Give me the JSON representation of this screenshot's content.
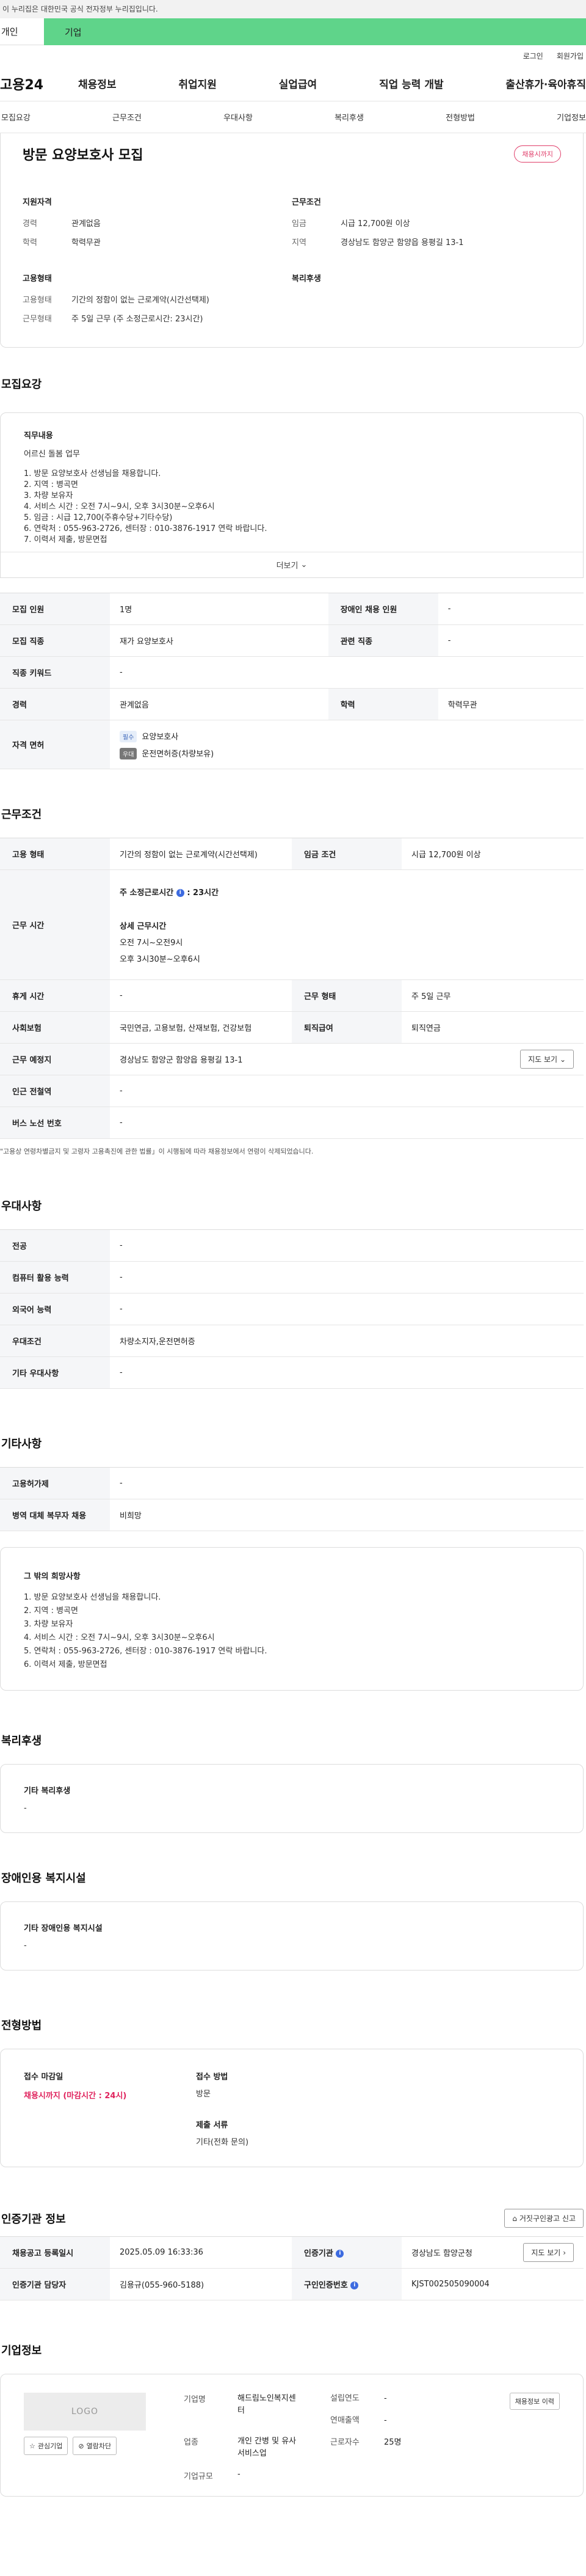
{
  "gov_banner": "이 누리집은 대한민국 공식 전자정부 누리집입니다.",
  "tabs": {
    "individual": "개인",
    "business": "기업"
  },
  "utility": {
    "login": "로그인",
    "signup": "회원가입"
  },
  "gnb": {
    "logo": "고용24",
    "items": [
      "채용정보",
      "취업지원",
      "실업급여",
      "직업 능력 개발",
      "출산휴가·육아휴직"
    ]
  },
  "subnav": [
    "모집요강",
    "근무조건",
    "우대사항",
    "복리후생",
    "전형방법",
    "기업정보"
  ],
  "summary": {
    "title": "방문 요양보호사 모집",
    "deadline_badge": "채용시까지",
    "qualification": {
      "head": "지원자격",
      "career_k": "경력",
      "career_v": "관계없음",
      "edu_k": "학력",
      "edu_v": "학력무관"
    },
    "conditions": {
      "head": "근무조건",
      "wage_k": "임금",
      "wage_v": "시급 12,700원 이상",
      "area_k": "지역",
      "area_v": "경상남도 함양군 함양읍 용평길 13-1"
    },
    "employment": {
      "head": "고용형태",
      "type_k": "고용형태",
      "type_v": "기간의 정함이 없는 근로계약(시간선택제)",
      "time_k": "근무형태",
      "time_v": "주 5일 근무 (주 소정근로시간: 23시간)"
    },
    "welfare": {
      "head": "복리후생"
    }
  },
  "requirements": {
    "section_title": "모집요강",
    "duty_label": "직무내용",
    "duty_lines": [
      "어르신 돌봄 업무",
      "",
      "1. 방문 요양보호사 선생님을 채용합니다.",
      "2. 지역 : 병곡면",
      "3. 차량 보유자",
      "4. 서비스 시간 : 오전 7시~9시, 오후 3시30분~오후6시",
      "5. 임금 : 시급 12,700(주휴수당+기타수당)",
      "6. 연락처 : 055-963-2726, 센터장 : 010-3876-1917 연락 바랍니다.",
      "7. 이력서 제출, 방문면접"
    ],
    "more": "더보기",
    "table": {
      "headcount_k": "모집 인원",
      "headcount_v": "1명",
      "disabled_k": "장애인 채용 인원",
      "disabled_v": "-",
      "job_k": "모집 직종",
      "job_v": "재가 요양보호사",
      "related_k": "관련 직종",
      "related_v": "-",
      "keyword_k": "직종 키워드",
      "keyword_v": "-",
      "career_k": "경력",
      "career_v": "관계없음",
      "edu_k": "학력",
      "edu_v": "학력무관",
      "license_k": "자격 면허",
      "license_req_chip": "필수",
      "license_req": "요양보호사",
      "license_opt_chip": "우대",
      "license_opt": "운전면허증(차량보유)"
    }
  },
  "work": {
    "section_title": "근무조건",
    "type_k": "고용 형태",
    "type_v": "기간의 정함이 없는 근로계약(시간선택제)",
    "wage_k": "임금 조건",
    "wage_v": "시급 12,700원 이상",
    "hours_k": "근무 시간",
    "hours_total": "주 소정근로시간",
    "hours_total_v": ": 23시간",
    "hours_detail_head": "상세 근무시간",
    "hours_detail_1": "오전 7시~오전9시",
    "hours_detail_2": "오후 3시30분~오후6시",
    "break_k": "휴게 시간",
    "break_v": "-",
    "shift_k": "근무 형태",
    "shift_v": "주 5일 근무",
    "insurance_k": "사회보험",
    "insurance_v": "국민연금, 고용보험, 산재보험, 건강보험",
    "severance_k": "퇴직급여",
    "severance_v": "퇴직연금",
    "location_k": "근무 예정지",
    "location_v": "경상남도 함양군 함양읍 용평길 13-1",
    "map_btn": "지도 보기",
    "subway_k": "인근 전철역",
    "subway_v": "-",
    "bus_k": "버스 노선 번호",
    "bus_v": "-",
    "note": "\"고용상 연령차별금지 및 고령자 고용촉진에 관한 법률」이 시행됨에 따라 채용정보에서 연령이 삭제되었습니다."
  },
  "preferences": {
    "section_title": "우대사항",
    "major_k": "전공",
    "major_v": "-",
    "computer_k": "컴퓨터 활용 능력",
    "computer_v": "-",
    "language_k": "외국어 능력",
    "language_v": "-",
    "pref_k": "우대조건",
    "pref_v": "차량소지자,운전면허증",
    "etc_k": "기타 우대사항",
    "etc_v": "-"
  },
  "others": {
    "section_title": "기타사항",
    "equipment_k": "고용허가제",
    "equipment_v": "-",
    "military_k": "병역 대체 복무자 채용",
    "military_v": "비희망",
    "hope_label": "그 밖의 희망사항",
    "hope_lines": [
      "1. 방문 요양보호사 선생님을 채용합니다.",
      "2. 지역 : 병곡면",
      "3. 차량 보유자",
      "4. 서비스 시간 : 오전 7시~9시, 오후 3시30분~오후6시",
      "5. 연락처 : 055-963-2726, 센터장 : 010-3876-1917 연락 바랍니다.",
      "6. 이력서 제출, 방문면접"
    ]
  },
  "welfare": {
    "section_title": "복리후생",
    "label": "기타 복리후생",
    "value": "-"
  },
  "disability": {
    "section_title": "장애인용 복지시설",
    "label": "기타 장애인용 복지시설",
    "value": "-"
  },
  "selection": {
    "section_title": "전형방법",
    "deadline_label": "접수 마감일",
    "deadline_value": "채용시까지 (마감시간 : 24시)",
    "method_label": "접수 방법",
    "method_value": "방문",
    "docs_label": "제출 서류",
    "docs_value": "기타(전화 문의)"
  },
  "certification": {
    "section_title": "인증기관 정보",
    "report_btn": "거짓구인광고 신고",
    "reg_k": "채용공고 등록일시",
    "reg_v": "2025.05.09 16:33:36",
    "org_k": "인증기관",
    "org_v": "경상남도 함양군청",
    "map_btn": "지도 보기",
    "manager_k": "인증기관 담당자",
    "manager_v": "김용규(055-960-5188)",
    "notice_k": "구인인증번호",
    "notice_v": "KJST002505090004"
  },
  "company": {
    "section_title": "기업정보",
    "logo": "LOGO",
    "interest_btn": "관심기업",
    "block_btn": "열람차단",
    "name_k": "기업명",
    "name_v1": "해드림노인복지센",
    "name_v2": "터",
    "founded_k": "설립연도",
    "founded_v": "-",
    "sales_k": "연매출액",
    "sales_v": "-",
    "industry_k": "업종",
    "industry_v1": "개인 간병 및 유사",
    "industry_v2": "서비스업",
    "staff_k": "근로자수",
    "staff_v": "25명",
    "size_k": "기업규모",
    "size_v": "-",
    "history_btn": "채용정보 이력"
  }
}
